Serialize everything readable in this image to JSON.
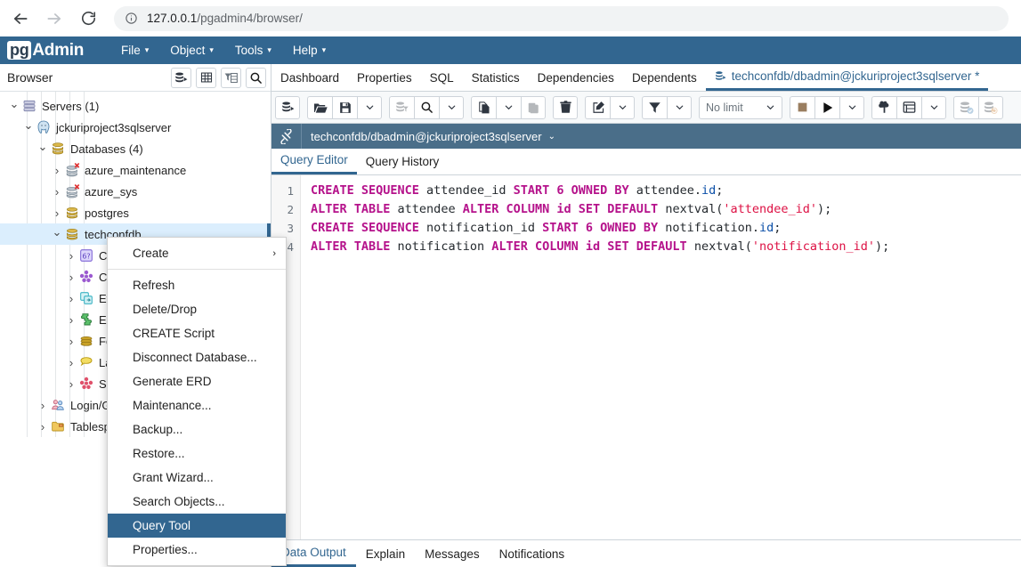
{
  "browser_chrome": {
    "back_icon": "back-arrow-icon",
    "forward_icon": "forward-arrow-icon",
    "reload_icon": "reload-icon",
    "info_icon": "site-info-icon",
    "url_host": "127.0.0.1",
    "url_path": "/pgadmin4/browser/"
  },
  "app": {
    "logo_pg": "pg",
    "logo_admin": "Admin",
    "menus": [
      {
        "label": "File"
      },
      {
        "label": "Object"
      },
      {
        "label": "Tools"
      },
      {
        "label": "Help"
      }
    ],
    "caret": "▾"
  },
  "browser_panel": {
    "title": "Browser",
    "header_buttons": [
      {
        "name": "object-explorer-icon"
      },
      {
        "name": "grid-view-icon"
      },
      {
        "name": "filter-table-icon"
      },
      {
        "name": "search-icon"
      }
    ],
    "tree": [
      {
        "label": "Servers (1)",
        "depth": 0,
        "twisty": "⌄",
        "icon": "servers-icon",
        "selected": false
      },
      {
        "label": "jckuriproject3sqlserver",
        "depth": 1,
        "twisty": "⌄",
        "icon": "postgres-server-icon",
        "selected": false
      },
      {
        "label": "Databases (4)",
        "depth": 2,
        "twisty": "⌄",
        "icon": "databases-icon",
        "selected": false
      },
      {
        "label": "azure_maintenance",
        "depth": 3,
        "twisty": "›",
        "icon": "database-disconnected-icon",
        "selected": false
      },
      {
        "label": "azure_sys",
        "depth": 3,
        "twisty": "›",
        "icon": "database-disconnected-icon",
        "selected": false
      },
      {
        "label": "postgres",
        "depth": 3,
        "twisty": "›",
        "icon": "database-icon",
        "selected": false
      },
      {
        "label": "techconfdb",
        "depth": 3,
        "twisty": "⌄",
        "icon": "database-icon",
        "selected": true
      },
      {
        "label": "Casts",
        "depth": 4,
        "twisty": "›",
        "icon": "casts-icon",
        "selected": false
      },
      {
        "label": "Catalogs",
        "depth": 4,
        "twisty": "›",
        "icon": "catalogs-icon",
        "selected": false
      },
      {
        "label": "Event Triggers",
        "depth": 4,
        "twisty": "›",
        "icon": "event-triggers-icon",
        "selected": false
      },
      {
        "label": "Extensions",
        "depth": 4,
        "twisty": "›",
        "icon": "extensions-icon",
        "selected": false
      },
      {
        "label": "Foreign Data Wrappers",
        "depth": 4,
        "twisty": "›",
        "icon": "fdw-icon",
        "selected": false
      },
      {
        "label": "Languages",
        "depth": 4,
        "twisty": "›",
        "icon": "languages-icon",
        "selected": false
      },
      {
        "label": "Schemas",
        "depth": 4,
        "twisty": "›",
        "icon": "schemas-icon",
        "selected": false
      },
      {
        "label": "Login/Group Roles",
        "depth": 2,
        "twisty": "›",
        "icon": "roles-icon",
        "selected": false
      },
      {
        "label": "Tablespaces",
        "depth": 2,
        "twisty": "›",
        "icon": "tablespaces-icon",
        "selected": false
      }
    ]
  },
  "context_menu": {
    "items": [
      {
        "label": "Create",
        "submenu": true,
        "highlighted": false,
        "separator_after": true
      },
      {
        "label": "Refresh",
        "submenu": false,
        "highlighted": false,
        "separator_after": false
      },
      {
        "label": "Delete/Drop",
        "submenu": false,
        "highlighted": false,
        "separator_after": false
      },
      {
        "label": "CREATE Script",
        "submenu": false,
        "highlighted": false,
        "separator_after": false
      },
      {
        "label": "Disconnect Database...",
        "submenu": false,
        "highlighted": false,
        "separator_after": false
      },
      {
        "label": "Generate ERD",
        "submenu": false,
        "highlighted": false,
        "separator_after": false
      },
      {
        "label": "Maintenance...",
        "submenu": false,
        "highlighted": false,
        "separator_after": false
      },
      {
        "label": "Backup...",
        "submenu": false,
        "highlighted": false,
        "separator_after": false
      },
      {
        "label": "Restore...",
        "submenu": false,
        "highlighted": false,
        "separator_after": false
      },
      {
        "label": "Grant Wizard...",
        "submenu": false,
        "highlighted": false,
        "separator_after": false
      },
      {
        "label": "Search Objects...",
        "submenu": false,
        "highlighted": false,
        "separator_after": false
      },
      {
        "label": "Query Tool",
        "submenu": false,
        "highlighted": true,
        "separator_after": false
      },
      {
        "label": "Properties...",
        "submenu": false,
        "highlighted": false,
        "separator_after": false
      }
    ],
    "submenu_arrow": "›"
  },
  "object_tabs": {
    "tabs": [
      {
        "label": "Dashboard",
        "active": false,
        "icon": null
      },
      {
        "label": "Properties",
        "active": false,
        "icon": null
      },
      {
        "label": "SQL",
        "active": false,
        "icon": null
      },
      {
        "label": "Statistics",
        "active": false,
        "icon": null
      },
      {
        "label": "Dependencies",
        "active": false,
        "icon": null
      },
      {
        "label": "Dependents",
        "active": false,
        "icon": null
      },
      {
        "label": "techconfdb/dbadmin@jckuriproject3sqlserver *",
        "active": true,
        "icon": "query-tool-icon"
      }
    ]
  },
  "query_toolbar": {
    "groups": [
      {
        "buttons": [
          {
            "name": "open-query-tool-icon",
            "disabled": false
          }
        ]
      },
      {
        "buttons": [
          {
            "name": "open-file-icon",
            "disabled": false
          },
          {
            "name": "save-file-icon",
            "disabled": false
          },
          {
            "name": "chevron-down-icon",
            "disabled": false
          }
        ]
      },
      {
        "buttons": [
          {
            "name": "edit-data-filter-icon",
            "disabled": true
          },
          {
            "name": "find-icon",
            "disabled": false
          },
          {
            "name": "chevron-down-icon",
            "disabled": false
          }
        ]
      },
      {
        "buttons": [
          {
            "name": "copy-icon",
            "disabled": false
          },
          {
            "name": "chevron-down-icon",
            "disabled": false
          },
          {
            "name": "paste-icon",
            "disabled": true
          }
        ]
      },
      {
        "buttons": [
          {
            "name": "delete-icon",
            "disabled": false
          }
        ]
      },
      {
        "buttons": [
          {
            "name": "edit-icon",
            "disabled": false
          },
          {
            "name": "chevron-down-icon",
            "disabled": false
          }
        ]
      },
      {
        "buttons": [
          {
            "name": "filter-icon",
            "disabled": false
          },
          {
            "name": "chevron-down-icon",
            "disabled": false
          }
        ]
      }
    ],
    "row_limit": {
      "value": "No limit",
      "caret": "⌄"
    },
    "groups_right": [
      {
        "buttons": [
          {
            "name": "stop-icon",
            "disabled": false
          },
          {
            "name": "execute-play-icon",
            "disabled": false
          },
          {
            "name": "chevron-down-icon",
            "disabled": false
          }
        ]
      },
      {
        "buttons": [
          {
            "name": "explain-icon",
            "disabled": false
          },
          {
            "name": "explain-analyze-icon",
            "disabled": false
          },
          {
            "name": "chevron-down-icon",
            "disabled": false
          }
        ]
      },
      {
        "buttons": [
          {
            "name": "commit-icon",
            "disabled": true
          },
          {
            "name": "rollback-icon",
            "disabled": true
          }
        ]
      }
    ]
  },
  "connection_bar": {
    "icon": "connection-icon",
    "name": "techconfdb/dbadmin@jckuriproject3sqlserver",
    "caret": "⌄"
  },
  "editor_tabs": {
    "tabs": [
      {
        "label": "Query Editor",
        "active": true
      },
      {
        "label": "Query History",
        "active": false
      }
    ]
  },
  "editor": {
    "line_numbers": [
      "1",
      "2",
      "3",
      "4"
    ],
    "lines": [
      [
        {
          "t": "CREATE SEQUENCE ",
          "c": "kw"
        },
        {
          "t": "attendee_id ",
          "c": "ident"
        },
        {
          "t": "START ",
          "c": "kw"
        },
        {
          "t": "6 ",
          "c": "num"
        },
        {
          "t": "OWNED BY ",
          "c": "kw"
        },
        {
          "t": "attendee",
          "c": "ident"
        },
        {
          "t": ".",
          "c": "punc"
        },
        {
          "t": "id",
          "c": "prop"
        },
        {
          "t": ";",
          "c": "punc"
        }
      ],
      [
        {
          "t": "ALTER TABLE ",
          "c": "kw"
        },
        {
          "t": "attendee ",
          "c": "ident"
        },
        {
          "t": "ALTER COLUMN ",
          "c": "kw"
        },
        {
          "t": "id ",
          "c": "kw"
        },
        {
          "t": "SET DEFAULT ",
          "c": "kw"
        },
        {
          "t": "nextval",
          "c": "ident"
        },
        {
          "t": "(",
          "c": "punc"
        },
        {
          "t": "'attendee_id'",
          "c": "str"
        },
        {
          "t": ");",
          "c": "punc"
        }
      ],
      [
        {
          "t": "CREATE SEQUENCE ",
          "c": "kw"
        },
        {
          "t": "notification_id ",
          "c": "ident"
        },
        {
          "t": "START ",
          "c": "kw"
        },
        {
          "t": "6 ",
          "c": "num"
        },
        {
          "t": "OWNED BY ",
          "c": "kw"
        },
        {
          "t": "notification",
          "c": "ident"
        },
        {
          "t": ".",
          "c": "punc"
        },
        {
          "t": "id",
          "c": "prop"
        },
        {
          "t": ";",
          "c": "punc"
        }
      ],
      [
        {
          "t": "ALTER TABLE ",
          "c": "kw"
        },
        {
          "t": "notification ",
          "c": "ident"
        },
        {
          "t": "ALTER COLUMN ",
          "c": "kw"
        },
        {
          "t": "id ",
          "c": "kw"
        },
        {
          "t": "SET DEFAULT ",
          "c": "kw"
        },
        {
          "t": "nextval",
          "c": "ident"
        },
        {
          "t": "(",
          "c": "punc"
        },
        {
          "t": "'notification_id'",
          "c": "str"
        },
        {
          "t": ");",
          "c": "punc"
        }
      ]
    ]
  },
  "output_tabs": {
    "tabs": [
      {
        "label": "Data Output",
        "active": true
      },
      {
        "label": "Explain",
        "active": false
      },
      {
        "label": "Messages",
        "active": false
      },
      {
        "label": "Notifications",
        "active": false
      }
    ]
  },
  "colors": {
    "brand": "#326690",
    "conn_bar": "#4a6e89",
    "selection": "#dbeefd",
    "toolbar_bg": "#f7f9fa"
  }
}
